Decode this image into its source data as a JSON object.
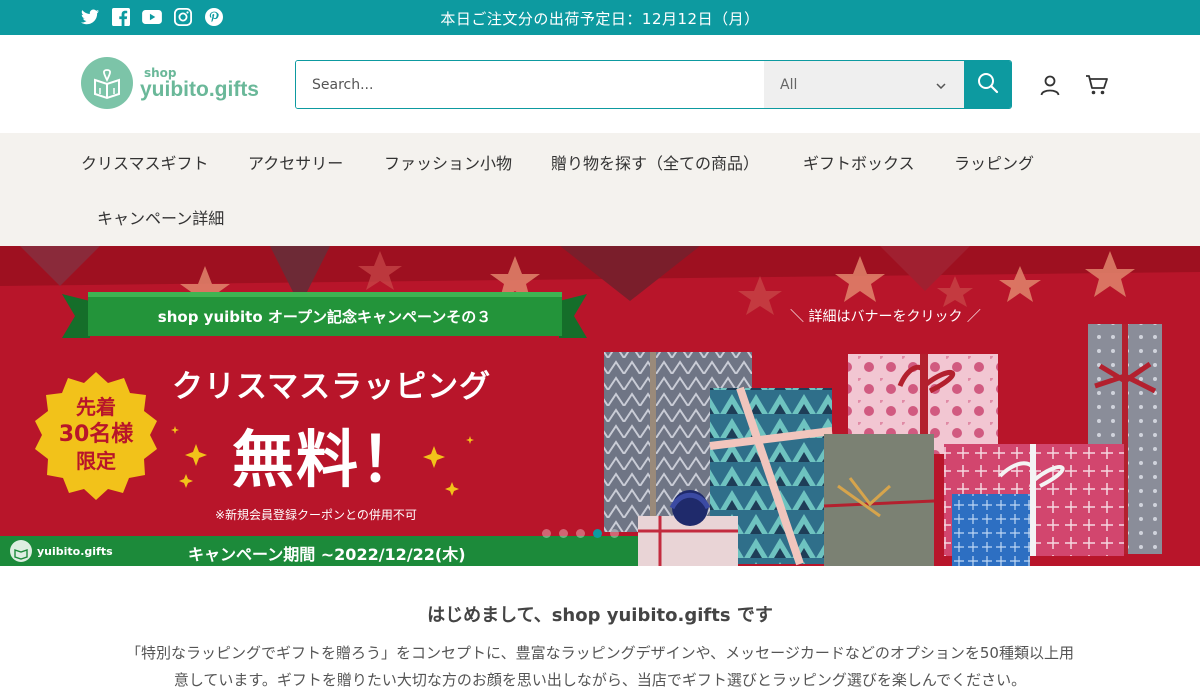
{
  "topbar": {
    "social_icons": [
      "twitter-icon",
      "facebook-icon",
      "youtube-icon",
      "instagram-icon",
      "pinterest-icon"
    ],
    "announcement": "本日ご注文分の出荷予定日：12月12日（月）",
    "bg_color": "#0d9aa0"
  },
  "header": {
    "logo_shop": "shop",
    "logo_name": "yuibito.gifts",
    "search_placeholder": "Search...",
    "category_selected": "All",
    "icons": [
      "search-icon",
      "account-icon",
      "cart-icon"
    ]
  },
  "nav": {
    "items": [
      "クリスマスギフト",
      "アクセサリー",
      "ファッション小物",
      "贈り物を探す（全ての商品）",
      "ギフトボックス",
      "ラッピング",
      "キャンペーン詳細"
    ]
  },
  "hero": {
    "ribbon_text": "shop yuibito オープン記念キャンペーンその３",
    "headline": "クリスマスラッピング",
    "free_text": "無料！",
    "note": "※新規会員登録クーポンとの併用不可",
    "badge_line1": "先着",
    "badge_line2": "30名様",
    "badge_line3": "限定",
    "click_note": "＼ 詳細はバナーをクリック ／",
    "period_logo": "yuibito.gifts",
    "period_text": "キャンペーン期間 ~2022/12/22(木)",
    "accent_red": "#b8152a",
    "accent_green": "#1c8a3a",
    "slide_count": 5,
    "active_slide": 4
  },
  "intro": {
    "title": "はじめまして、shop yuibito.gifts です",
    "body": "「特別なラッピングでギフトを贈ろう」をコンセプトに、豊富なラッピングデザインや、メッセージカードなどのオプションを50種類以上用意しています。ギフトを贈りたい大切な方のお顔を思い出しながら、当店でギフト選びとラッピング選びを楽しんでください。"
  }
}
